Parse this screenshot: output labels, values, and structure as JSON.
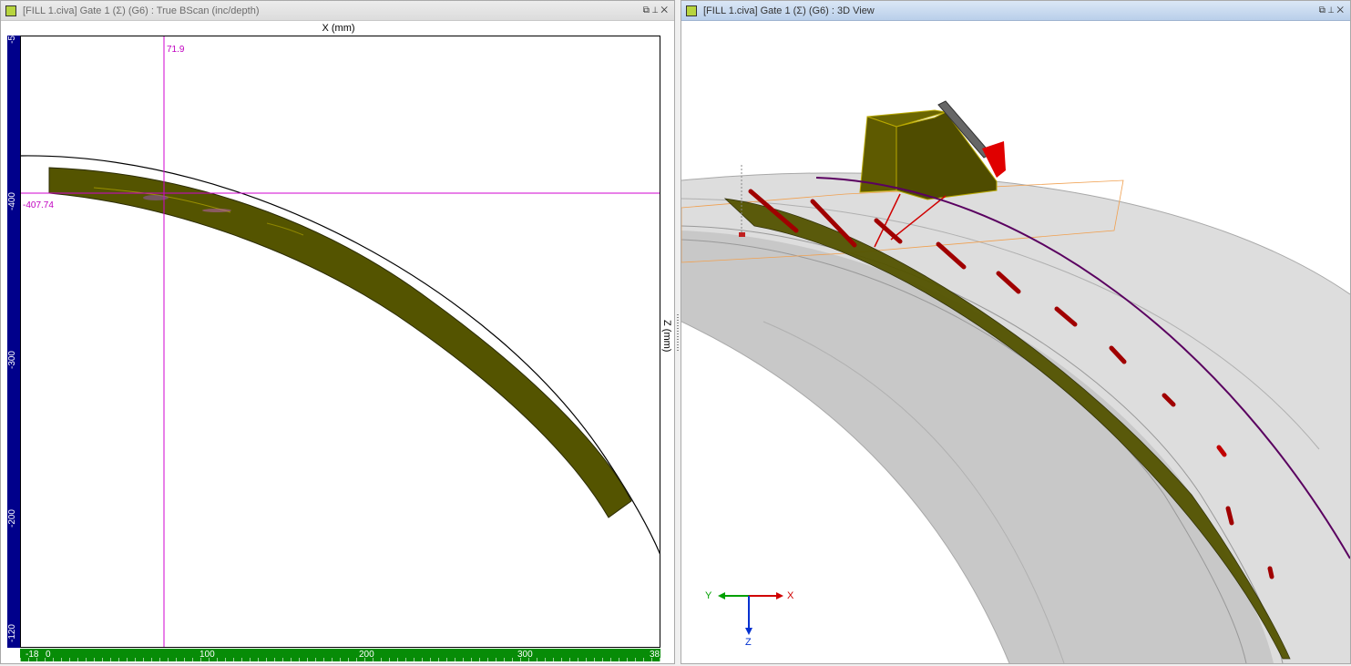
{
  "left_panel": {
    "title": "[FILL 1.civa] Gate 1 (Σ) (G6) : True BScan (inc/depth)",
    "controls": "⧉ ☉ ✕",
    "x_axis_title": "X (mm)",
    "z_axis_title": "Z (mm)",
    "cursor_x_label": "71.9",
    "cursor_z_label": "-407.74",
    "v_ruler_ticks": [
      "-5",
      "-400",
      "-300",
      "-200",
      "-120"
    ],
    "h_ruler_ticks": [
      "-18",
      "0",
      "100",
      "200",
      "300",
      "38"
    ]
  },
  "right_panel": {
    "title": "[FILL 1.civa] Gate 1 (Σ) (G6) : 3D View",
    "controls": "⧉ ☉ ✕",
    "axes": {
      "y": "Y",
      "x": "X",
      "z": "Z"
    }
  },
  "colors": {
    "weld_fill": "#545400",
    "cursor": "#d000d0",
    "vertical_ruler": "#00008b",
    "horizontal_ruler": "#078c07",
    "probe_body": "#5f5c02",
    "defect_red": "#a00000",
    "pipe_gray": "#d6d6d6",
    "arc_purple": "#5a0060"
  }
}
